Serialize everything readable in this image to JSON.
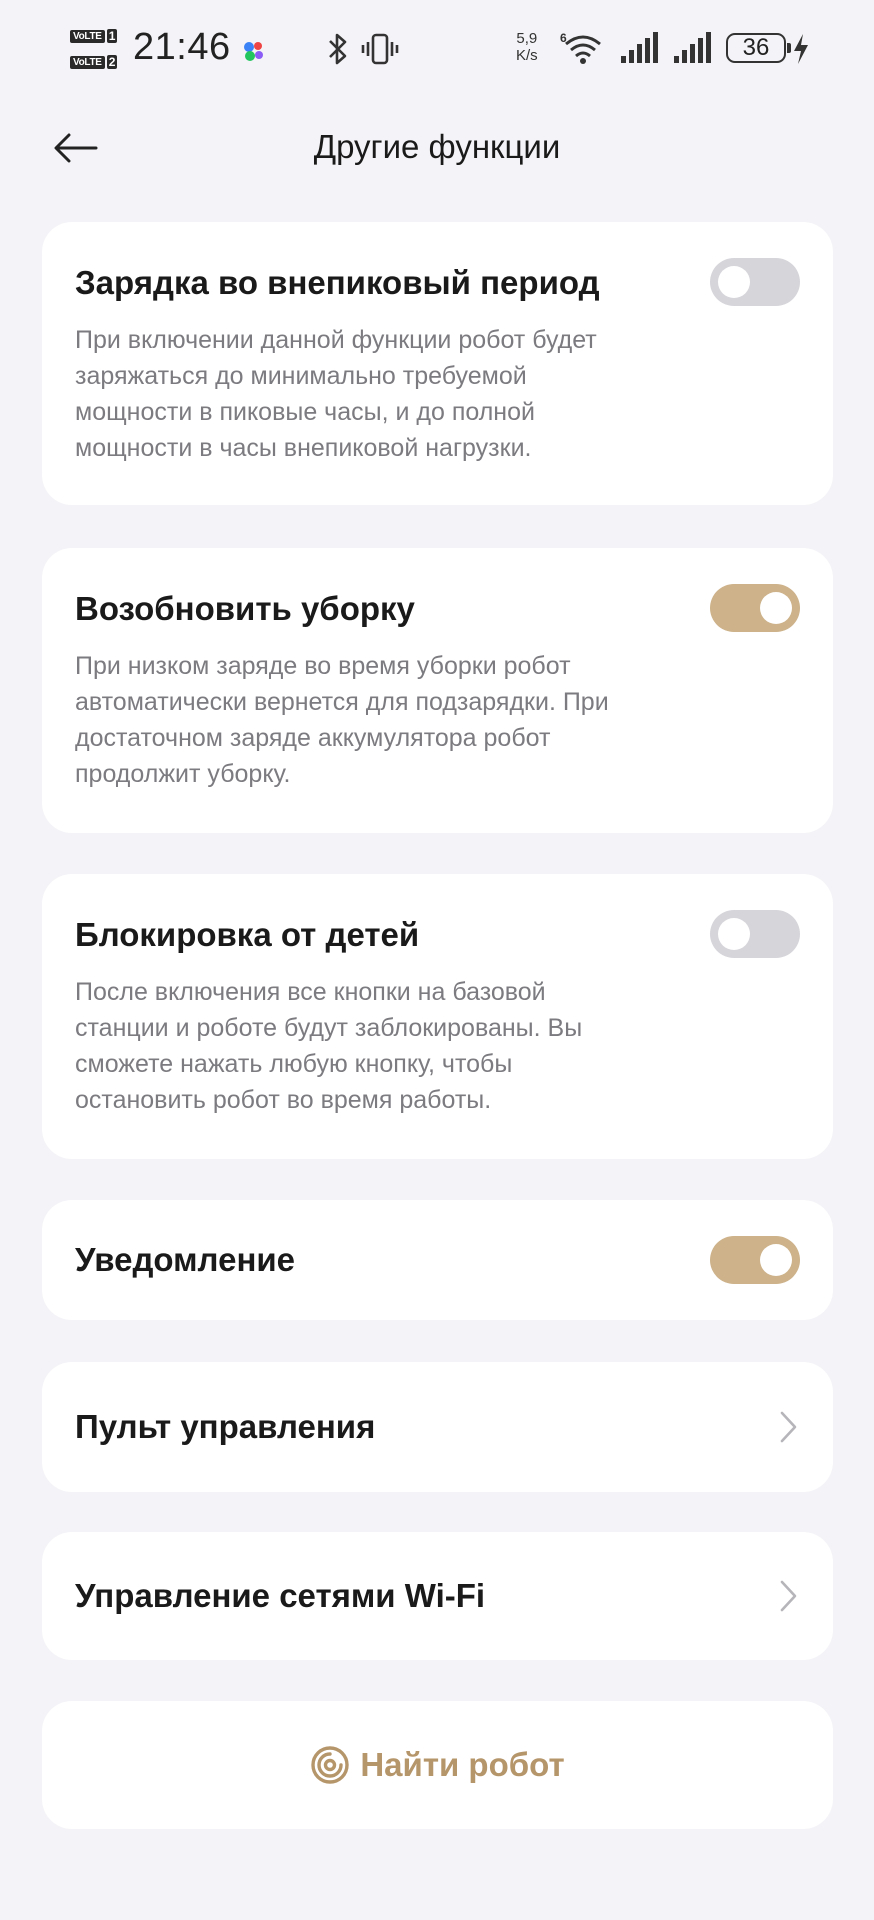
{
  "status_bar": {
    "volte1": "VoLTE",
    "sim1": "1",
    "volte2": "VoLTE",
    "sim2": "2",
    "time": "21:46",
    "speed_value": "5,9",
    "speed_unit": "K/s",
    "wifi_badge": "6",
    "battery": "36"
  },
  "header": {
    "title": "Другие функции"
  },
  "settings": [
    {
      "title": "Зарядка во внепиковый период",
      "description": "При включении данной функции робот будет заряжаться до минимально требуемой мощности в пиковые часы, и до полной мощности в часы внепиковой нагрузки.",
      "enabled": false
    },
    {
      "title": "Возобновить уборку",
      "description": "При низком заряде во время уборки робот автоматически вернется для подзарядки. При достаточном заряде аккумулятора робот продолжит уборку.",
      "enabled": true
    },
    {
      "title": "Блокировка от детей",
      "description": "После включения все кнопки на базовой станции и роботе будут заблокированы. Вы сможете нажать любую кнопку, чтобы остановить робот во время работы.",
      "enabled": false
    },
    {
      "title": "Уведомление",
      "enabled": true
    }
  ],
  "links": [
    {
      "label": "Пульт управления"
    },
    {
      "label": "Управление сетями Wi-Fi"
    }
  ],
  "find_robot": {
    "label": "Найти робот",
    "icon": "target-icon"
  },
  "colors": {
    "accent": "#cdb28a",
    "accent_text": "#b5956a",
    "toggle_off": "#d6d5da",
    "background": "#f4f3f7",
    "card": "#ffffff"
  }
}
